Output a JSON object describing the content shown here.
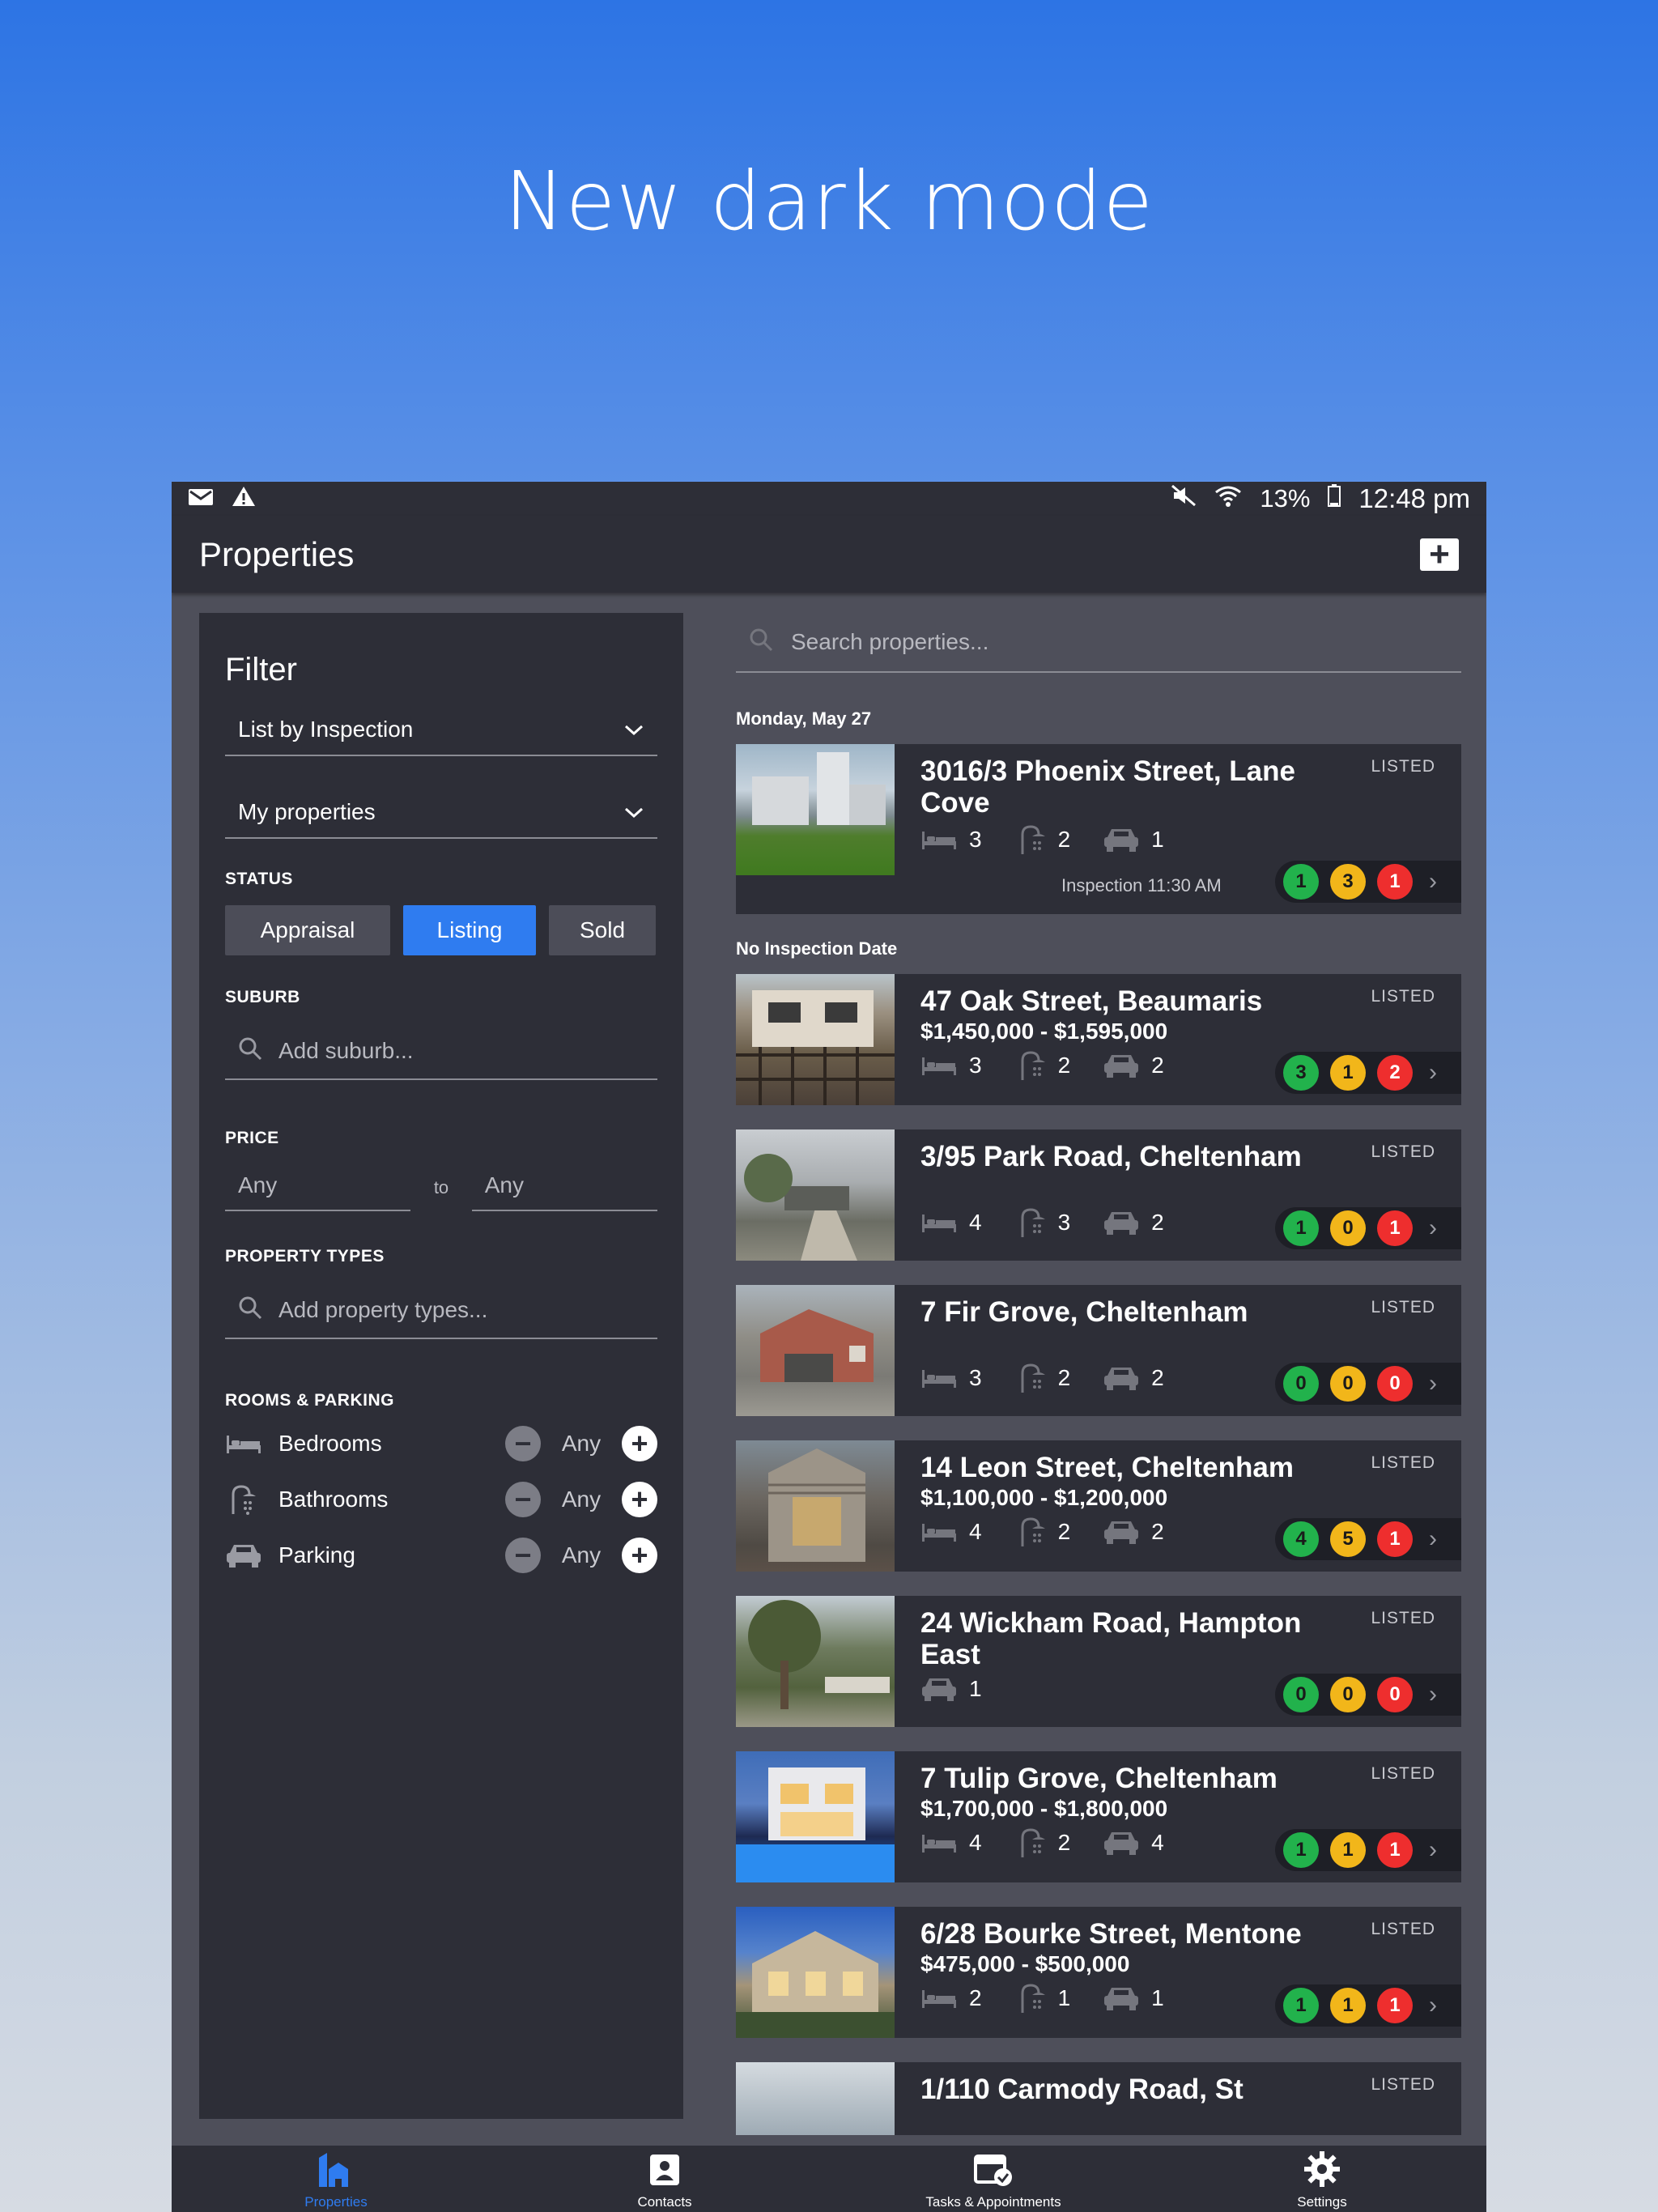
{
  "headline": "New dark mode",
  "statusbar": {
    "battery": "13%",
    "time": "12:48 pm"
  },
  "appbar": {
    "title": "Properties",
    "add_label": "+"
  },
  "filter": {
    "title": "Filter",
    "sort_select": "List by Inspection",
    "owner_select": "My properties",
    "status_label": "STATUS",
    "status_options": [
      "Appraisal",
      "Listing",
      "Sold"
    ],
    "status_selected": "Listing",
    "suburb_label": "SUBURB",
    "suburb_placeholder": "Add suburb...",
    "price_label": "PRICE",
    "price_min": "Any",
    "price_to": "to",
    "price_max": "Any",
    "types_label": "PROPERTY TYPES",
    "types_placeholder": "Add property types...",
    "rooms_label": "ROOMS & PARKING",
    "rooms": [
      {
        "label": "Bedrooms",
        "value": "Any",
        "icon": "bed-icon"
      },
      {
        "label": "Bathrooms",
        "value": "Any",
        "icon": "shower-icon"
      },
      {
        "label": "Parking",
        "value": "Any",
        "icon": "car-icon"
      }
    ]
  },
  "search": {
    "placeholder": "Search properties..."
  },
  "groups": [
    {
      "label": "Monday, May 27"
    },
    {
      "label": "No Inspection Date"
    }
  ],
  "properties": [
    {
      "title": "3016/3 Phoenix Street, Lane Cove",
      "price": "",
      "tag": "LISTED",
      "beds": "3",
      "baths": "2",
      "cars": "1",
      "inspection": "Inspection 11:30 AM",
      "counts": [
        "1",
        "3",
        "1"
      ]
    },
    {
      "title": "47 Oak Street, Beaumaris",
      "price": "$1,450,000 - $1,595,000",
      "tag": "LISTED",
      "beds": "3",
      "baths": "2",
      "cars": "2",
      "counts": [
        "3",
        "1",
        "2"
      ]
    },
    {
      "title": "3/95 Park Road, Cheltenham",
      "price": "",
      "tag": "LISTED",
      "beds": "4",
      "baths": "3",
      "cars": "2",
      "counts": [
        "1",
        "0",
        "1"
      ]
    },
    {
      "title": "7 Fir Grove, Cheltenham",
      "price": "",
      "tag": "LISTED",
      "beds": "3",
      "baths": "2",
      "cars": "2",
      "counts": [
        "0",
        "0",
        "0"
      ]
    },
    {
      "title": "14 Leon Street, Cheltenham",
      "price": "$1,100,000 - $1,200,000",
      "tag": "LISTED",
      "beds": "4",
      "baths": "2",
      "cars": "2",
      "counts": [
        "4",
        "5",
        "1"
      ]
    },
    {
      "title": "24 Wickham Road, Hampton East",
      "price": "",
      "tag": "LISTED",
      "cars": "1",
      "counts": [
        "0",
        "0",
        "0"
      ]
    },
    {
      "title": "7 Tulip Grove, Cheltenham",
      "price": "$1,700,000 - $1,800,000",
      "tag": "LISTED",
      "beds": "4",
      "baths": "2",
      "cars": "4",
      "counts": [
        "1",
        "1",
        "1"
      ]
    },
    {
      "title": "6/28 Bourke Street, Mentone",
      "price": "$475,000 - $500,000",
      "tag": "LISTED",
      "beds": "2",
      "baths": "1",
      "cars": "1",
      "counts": [
        "1",
        "1",
        "1"
      ]
    },
    {
      "title": "1/110 Carmody Road, St",
      "price": "",
      "tag": "LISTED"
    }
  ],
  "bottomnav": [
    {
      "label": "Properties",
      "icon": "properties-icon",
      "active": true
    },
    {
      "label": "Contacts",
      "icon": "contacts-icon"
    },
    {
      "label": "Tasks & Appointments",
      "icon": "calendar-check-icon"
    },
    {
      "label": "Settings",
      "icon": "gear-icon"
    }
  ],
  "colors": {
    "accent": "#2f7cf0",
    "surface": "#2d2e37",
    "background": "#4e4f5a",
    "green": "#22b24c",
    "yellow": "#f2b61a",
    "red": "#ee2e2e"
  }
}
